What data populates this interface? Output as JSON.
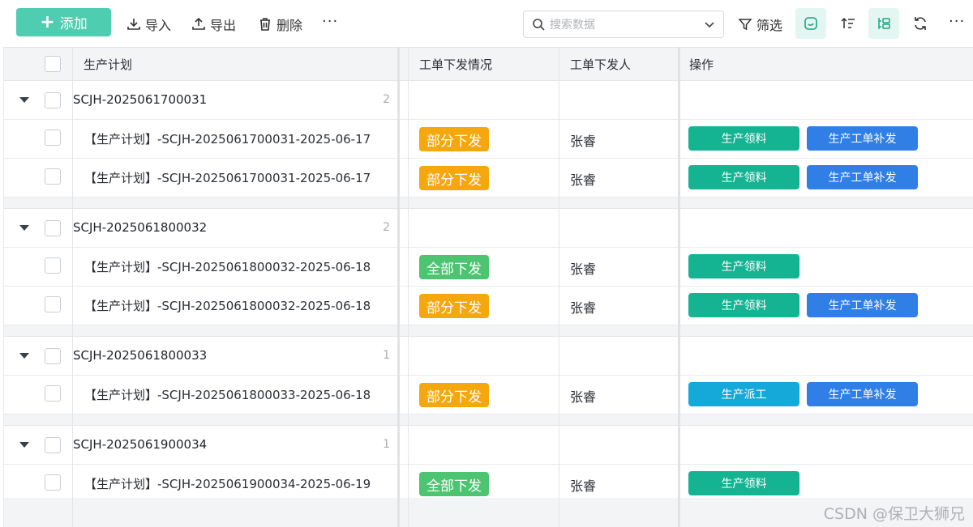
{
  "toolbar": {
    "add_label": "添加",
    "import_label": "导入",
    "export_label": "导出",
    "delete_label": "删除",
    "more_label": "···",
    "search_placeholder": "搜索数据",
    "filter_label": "筛选",
    "accent_color": "#4fcdb1"
  },
  "table": {
    "columns": [
      "生产计划",
      "工单下发情况",
      "工单下发人",
      "操作"
    ]
  },
  "groups": [
    {
      "title": "SCJH-2025061700031",
      "count": "2",
      "rows": [
        {
          "title": "【生产计划】-SCJH-2025061700031-2025-06-17",
          "status": "部分下发",
          "person": "张睿",
          "op1": "生产领料",
          "op2": "生产工单补发"
        },
        {
          "title": "【生产计划】-SCJH-2025061700031-2025-06-17",
          "status": "部分下发",
          "person": "张睿",
          "op1": "生产领料",
          "op2": "生产工单补发"
        }
      ]
    },
    {
      "title": "SCJH-2025061800032",
      "count": "2",
      "rows": [
        {
          "title": "【生产计划】-SCJH-2025061800032-2025-06-18",
          "status": "全部下发",
          "person": "张睿",
          "op1": "生产领料",
          "op2": ""
        },
        {
          "title": "【生产计划】-SCJH-2025061800032-2025-06-18",
          "status": "部分下发",
          "person": "张睿",
          "op1": "生产领料",
          "op2": "生产工单补发"
        }
      ]
    },
    {
      "title": "SCJH-2025061800033",
      "count": "1",
      "rows": [
        {
          "title": "【生产计划】-SCJH-2025061800033-2025-06-18",
          "status": "部分下发",
          "person": "张睿",
          "op1": "生产派工",
          "op2": "生产工单补发"
        }
      ]
    },
    {
      "title": "SCJH-2025061900034",
      "count": "1",
      "rows": [
        {
          "title": "【生产计划】-SCJH-2025061900034-2025-06-19",
          "status": "全部下发",
          "person": "张睿",
          "op1": "生产领料",
          "op2": ""
        }
      ]
    }
  ],
  "colors": {
    "partial": "#f5a70e",
    "full": "#4cc470",
    "op_material": "#14b392",
    "op_dispatch": "#15a9d9",
    "op_reissue": "#2f7fe6"
  },
  "watermark": "CSDN @保卫大狮兄"
}
